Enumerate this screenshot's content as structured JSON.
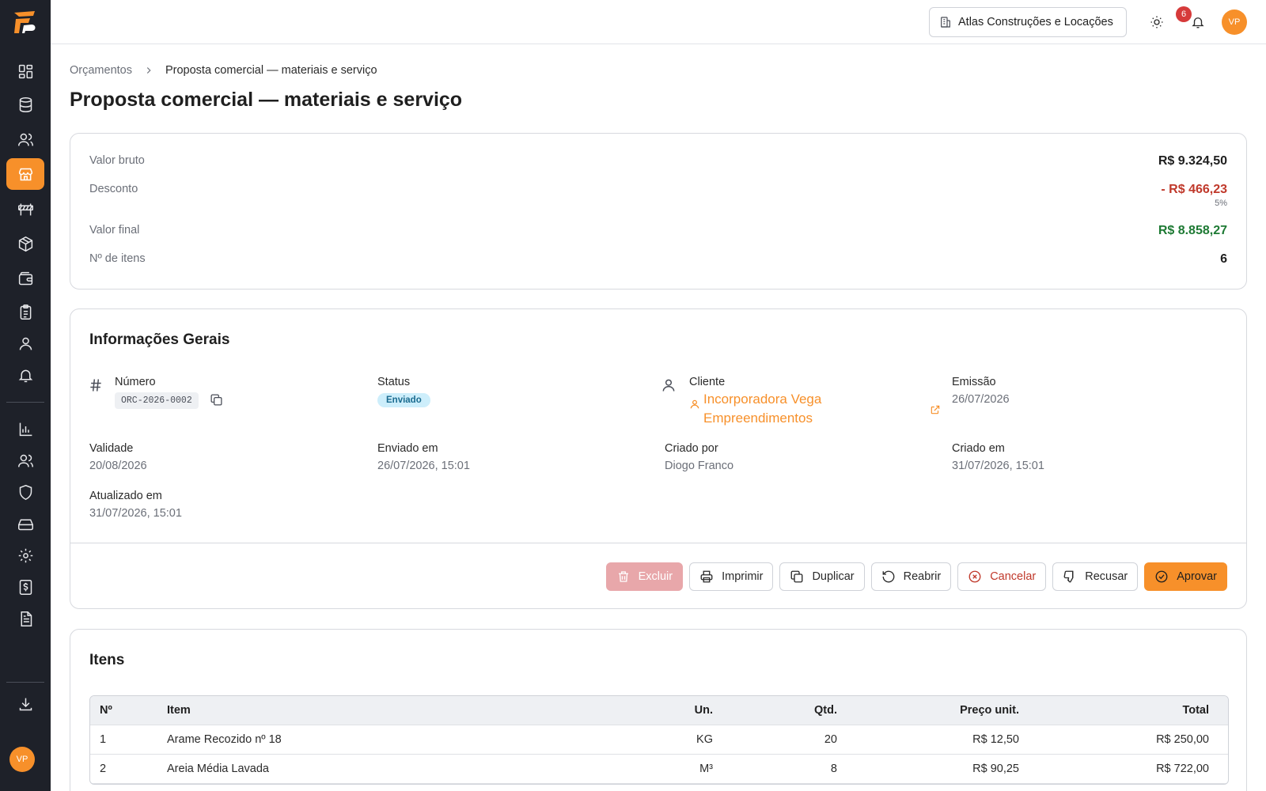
{
  "header": {
    "company": "Atlas Construções e Locações",
    "notifications_count": "6",
    "user_initials": "VP"
  },
  "sidebar": {
    "user_initials": "VP"
  },
  "breadcrumb": {
    "parent": "Orçamentos",
    "current": "Proposta comercial — materiais e serviço"
  },
  "page_title": "Proposta comercial — materiais e serviço",
  "summary": {
    "gross_label": "Valor bruto",
    "gross_value": "R$ 9.324,50",
    "discount_label": "Desconto",
    "discount_value": "- R$ 466,23",
    "discount_percent": "5%",
    "final_label": "Valor final",
    "final_value": "R$ 8.858,27",
    "items_label": "Nº de itens",
    "items_value": "6"
  },
  "info": {
    "title": "Informações Gerais",
    "number_label": "Número",
    "number_value": "ORC-2026-0002",
    "status_label": "Status",
    "status_value": "Enviado",
    "client_label": "Cliente",
    "client_value": "Incorporadora Vega Empreendimentos",
    "issue_label": "Emissão",
    "issue_value": "26/07/2026",
    "validity_label": "Validade",
    "validity_value": "20/08/2026",
    "sent_label": "Enviado em",
    "sent_value": "26/07/2026, 15:01",
    "created_by_label": "Criado por",
    "created_by_value": "Diogo Franco",
    "created_at_label": "Criado em",
    "created_at_value": "31/07/2026, 15:01",
    "updated_label": "Atualizado em",
    "updated_value": "31/07/2026, 15:01"
  },
  "actions": {
    "delete": "Excluir",
    "print": "Imprimir",
    "duplicate": "Duplicar",
    "reopen": "Reabrir",
    "cancel": "Cancelar",
    "refuse": "Recusar",
    "approve": "Aprovar"
  },
  "items": {
    "title": "Itens",
    "columns": [
      "Nº",
      "Item",
      "Un.",
      "Qtd.",
      "Preço unit.",
      "Total"
    ],
    "rows": [
      {
        "n": "1",
        "item": "Arame Recozido nº 18",
        "un": "KG",
        "qtd": "20",
        "price": "R$ 12,50",
        "total": "R$ 250,00"
      },
      {
        "n": "2",
        "item": "Areia Média Lavada",
        "un": "M³",
        "qtd": "8",
        "price": "R$ 90,25",
        "total": "R$ 722,00"
      }
    ]
  },
  "colors": {
    "accent": "#f7902a",
    "sidebar_bg": "#1e2129",
    "negative": "#c0392b",
    "positive": "#1e7a34"
  }
}
